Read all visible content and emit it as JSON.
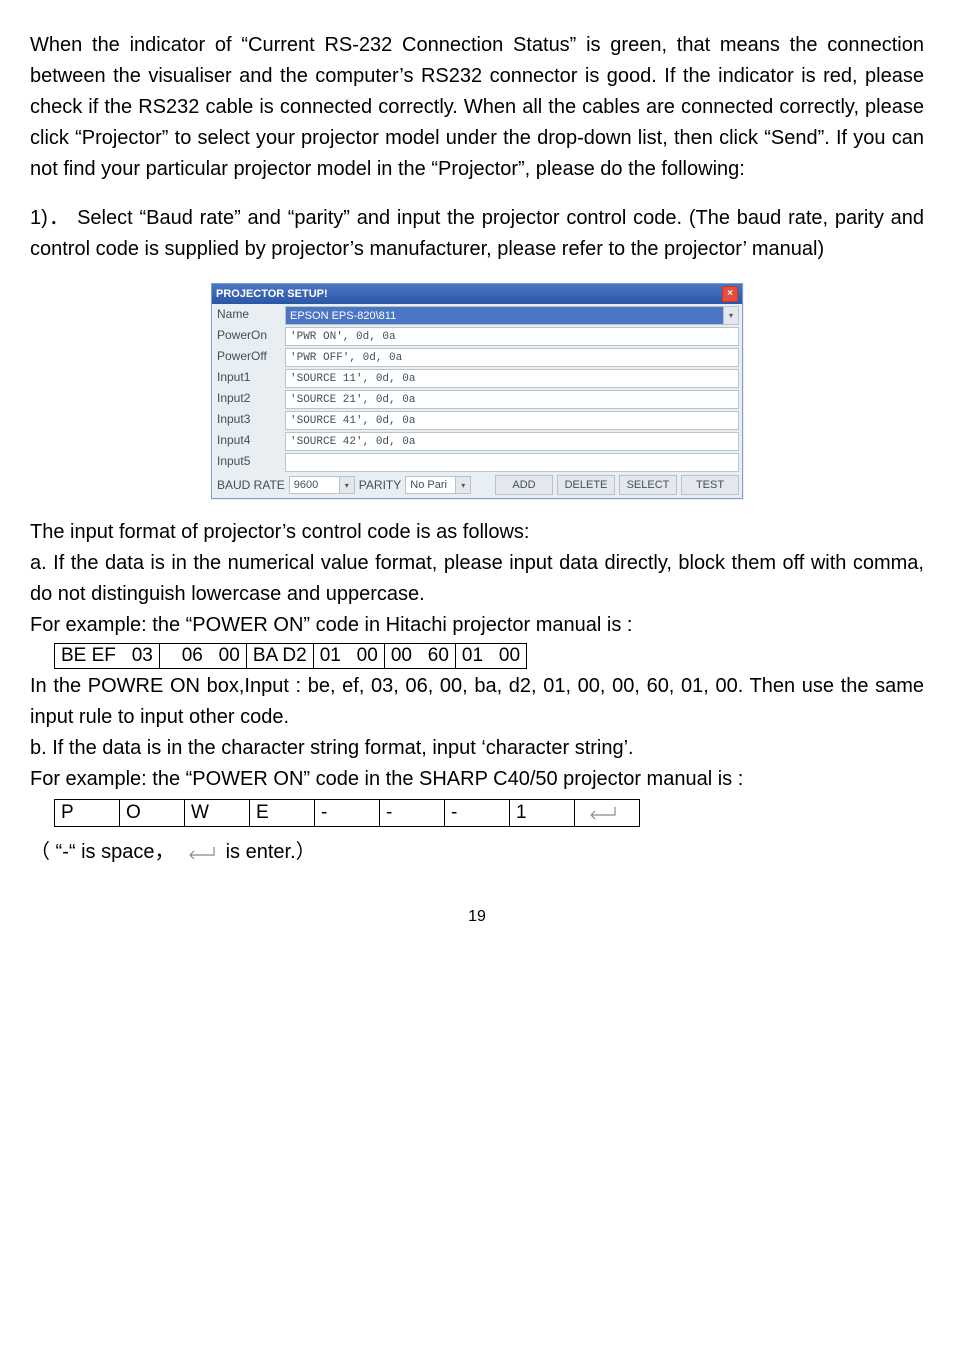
{
  "para1": "When the indicator of “Current RS-232 Connection Status” is green, that means the connection between the visualiser and the computer’s RS232 connector is good. If the indicator is red, please check if the RS232 cable is connected correctly. When all the cables are connected correctly, please click “Projector” to select your projector model under the drop-down list, then click “Send”. If you can not find your particular projector model in the “Projector”, please do the following:",
  "para2": "1)． Select “Baud rate” and “parity” and input the projector control code. (The baud rate, parity and control code is supplied by projector’s manufacturer, please refer to the projector’ manual)",
  "dlg": {
    "title": "PROJECTOR SETUP!",
    "labels": {
      "name": "Name",
      "poweron": "PowerOn",
      "poweroff": "PowerOff",
      "input1": "Input1",
      "input2": "Input2",
      "input3": "Input3",
      "input4": "Input4",
      "input5": "Input5",
      "baud": "BAUD RATE",
      "parity": "PARITY"
    },
    "values": {
      "name": "EPSON EPS-820\\811",
      "poweron": "'PWR ON', 0d, 0a",
      "poweroff": "'PWR OFF', 0d, 0a",
      "input1": "'SOURCE 11', 0d, 0a",
      "input2": "'SOURCE 21', 0d, 0a",
      "input3": "'SOURCE 41', 0d, 0a",
      "input4": "'SOURCE 42', 0d, 0a",
      "input5": "",
      "baud": "9600",
      "parity": "No Pari"
    },
    "buttons": {
      "add": "ADD",
      "delete": "DELETE",
      "select": "SELECT",
      "test": "TEST"
    }
  },
  "para3": "The input format of projector’s control code is as follows:",
  "para4": "a. If the data is in the numerical value format, please input data directly, block them off with comma, do not distinguish lowercase and uppercase.",
  "para5": "For example: the “POWER ON” code in Hitachi projector manual is :",
  "codeCells": [
    "BE EF   03",
    "   06   00",
    "BA D2",
    "01   00",
    "00   60",
    "01   00"
  ],
  "para6": "In the POWRE ON box,Input : be, ef, 03, 06, 00, ba, d2, 01, 00, 00, 60, 01, 00. Then use the same input rule to input other code.",
  "para7": "b. If the data is in the character string format, input ‘character string’.",
  "para8": "For example: the “POWER ON” code in the SHARP C40/50 projector manual is :",
  "poweCells": [
    "P",
    "O",
    "W",
    "E",
    "-",
    "-",
    "-",
    "1",
    ""
  ],
  "note_pre": "（ “-“ is space，",
  "note_post": " is enter.）",
  "pagenum": "19"
}
